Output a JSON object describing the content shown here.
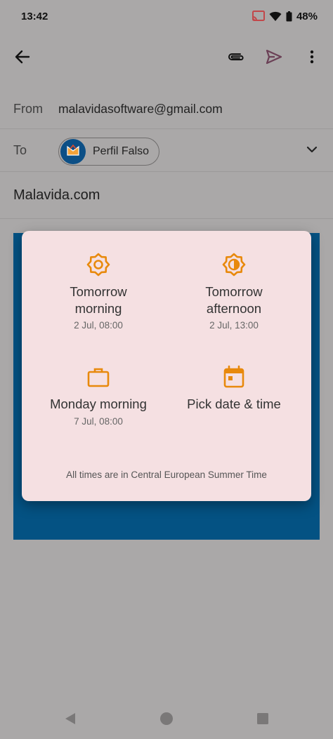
{
  "status_bar": {
    "time": "13:42",
    "battery": "48%"
  },
  "toolbar": {
    "back_icon": "arrow-back-icon",
    "attach_icon": "paperclip-icon",
    "send_icon": "send-icon",
    "more_icon": "more-vert-icon"
  },
  "compose": {
    "from_label": "From",
    "from_value": "malavidasoftware@gmail.com",
    "to_label": "To",
    "recipient_name": "Perfil Falso",
    "subject": "Malavida.com"
  },
  "schedule_dialog": {
    "options": [
      {
        "icon": "sun-icon",
        "title": "Tomorrow\nmorning",
        "subtitle": "2 Jul, 08:00"
      },
      {
        "icon": "half-sun-icon",
        "title": "Tomorrow\nafternoon",
        "subtitle": "2 Jul, 13:00"
      },
      {
        "icon": "briefcase-icon",
        "title": "Monday morning",
        "subtitle": "7 Jul, 08:00"
      },
      {
        "icon": "calendar-icon",
        "title": "Pick date & time",
        "subtitle": ""
      }
    ],
    "timezone_note": "All times are in Central European Summer Time"
  },
  "colors": {
    "accent_orange": "#e8890c",
    "send_purple": "#6b4056",
    "dialog_bg": "#f5e0e2",
    "image_blue": "#045283"
  }
}
